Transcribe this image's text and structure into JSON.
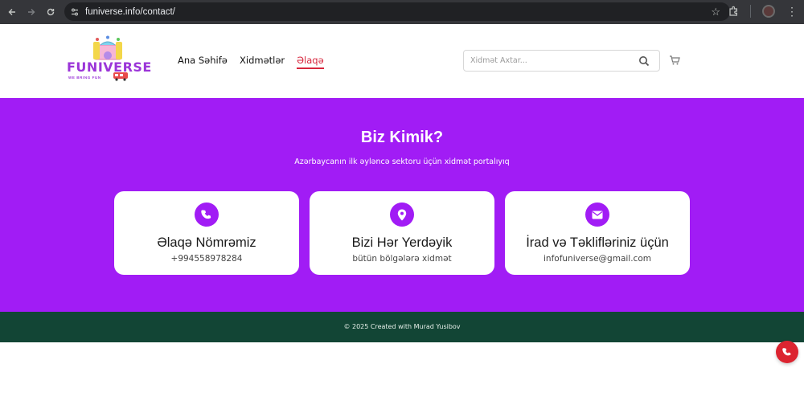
{
  "browser": {
    "url": "funiverse.info/contact/",
    "back_icon": "back-arrow-icon",
    "forward_icon": "forward-arrow-icon",
    "reload_icon": "reload-icon"
  },
  "header": {
    "logo_text": "FUNIVERSE",
    "logo_sub": "WE BRING FUN",
    "nav": [
      {
        "label": "Ana Səhifə"
      },
      {
        "label": "Xidmətlər"
      },
      {
        "label": "Əlaqə",
        "active": true
      }
    ],
    "search_placeholder": "Xidmət Axtar...",
    "colors": {
      "accent": "#d7263d",
      "brand": "#9b35d8"
    }
  },
  "hero": {
    "title": "Biz Kimik?",
    "subtitle": "Azərbaycanın ilk əyləncə sektoru üçün xidmət portalıyıq",
    "background": "#a11cf5",
    "cards": [
      {
        "icon": "phone-icon",
        "title": "Əlaqə Nömrəmiz",
        "value": "+994558978284"
      },
      {
        "icon": "map-pin-icon",
        "title": "Bizi Hər Yerdəyik",
        "value": "bütün bölgələrə xidmət"
      },
      {
        "icon": "envelope-icon",
        "title": "İrad və Təklifləriniz üçün",
        "value": "infofuniverse@gmail.com"
      }
    ]
  },
  "footer": {
    "text": "© 2025 Created with Murad Yusibov",
    "background": "#124535"
  },
  "fab": {
    "icon": "phone-icon",
    "color": "#dc2430"
  }
}
